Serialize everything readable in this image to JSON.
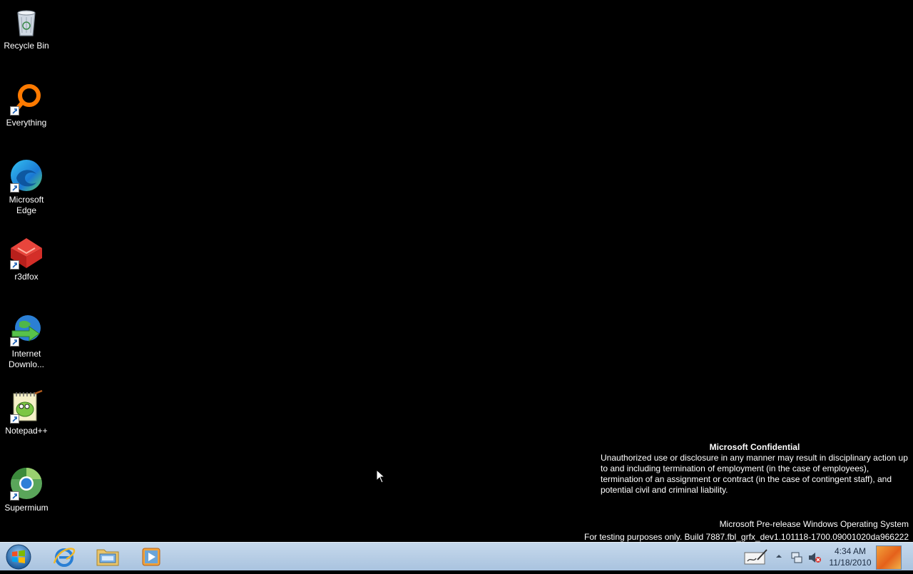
{
  "desktop": {
    "background": "#000000",
    "icons": [
      {
        "label": "Recycle Bin",
        "icon": "recycle-bin-icon",
        "shortcut": false
      },
      {
        "label": "Everything",
        "icon": "everything-icon",
        "shortcut": true
      },
      {
        "label": "Microsoft Edge",
        "icon": "edge-icon",
        "shortcut": true
      },
      {
        "label": "r3dfox",
        "icon": "r3dfox-icon",
        "shortcut": true
      },
      {
        "label": "Internet Downlo...",
        "icon": "internet-download-manager-icon",
        "shortcut": true
      },
      {
        "label": "Notepad++",
        "icon": "notepad-plus-plus-icon",
        "shortcut": true
      },
      {
        "label": "Supermium",
        "icon": "supermium-icon",
        "shortcut": true
      }
    ]
  },
  "watermark": {
    "title": "Microsoft Confidential",
    "body": "Unauthorized use or disclosure in any manner may result in disciplinary action up to and including termination of employment (in the case of employees), termination of an assignment or contract (in the case of contingent staff), and potential civil and criminal liability.",
    "os_name": "Microsoft Pre-release Windows Operating System",
    "build": "For testing purposes only. Build 7887.fbl_grfx_dev1.101118-1700.09001020da966222"
  },
  "taskbar": {
    "start_icon": "windows-start-orb-icon",
    "pinned": [
      {
        "name": "internet-explorer",
        "icon": "internet-explorer-icon"
      },
      {
        "name": "file-explorer",
        "icon": "folder-library-icon"
      },
      {
        "name": "media-player",
        "icon": "media-player-icon"
      }
    ],
    "tray": {
      "icons": [
        "pen-input-icon",
        "show-hidden-icons-chevron-icon",
        "network-icon",
        "volume-muted-icon"
      ],
      "time": "4:34 AM",
      "date": "11/18/2010"
    }
  },
  "colors": {
    "taskbar": "#b3cbe4",
    "accent_orange": "#f07d1a"
  }
}
